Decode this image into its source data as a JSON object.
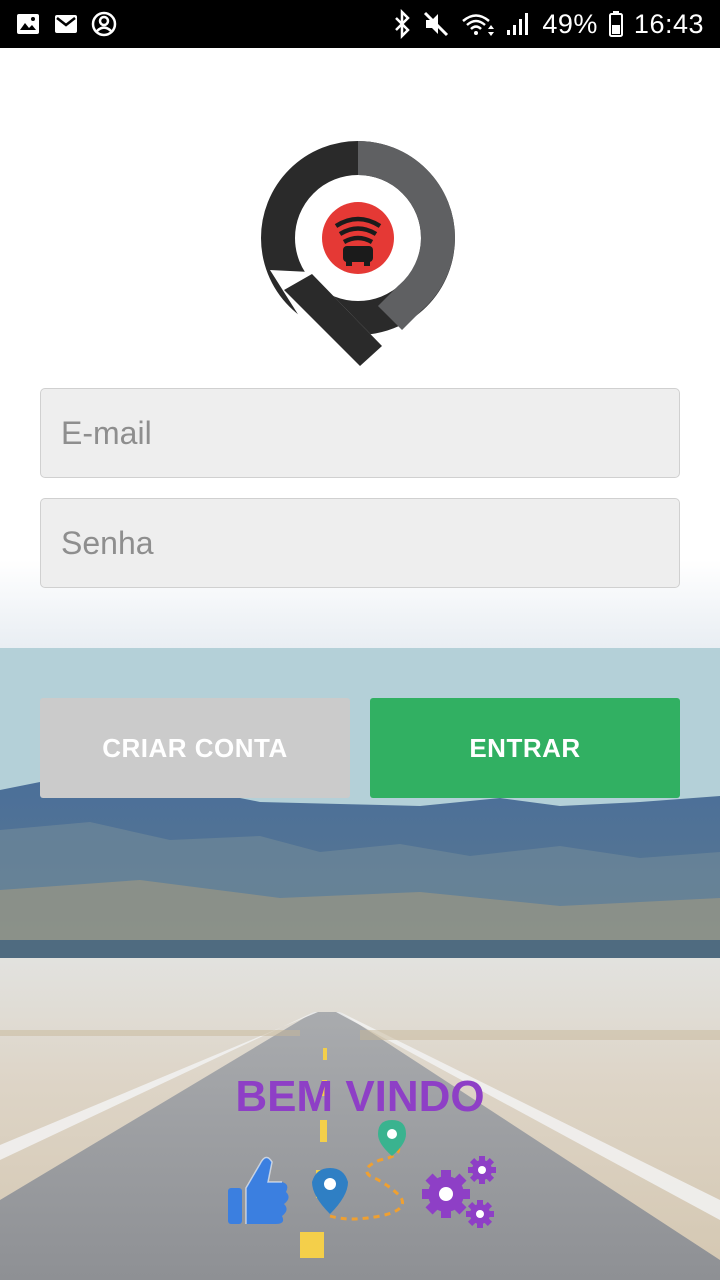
{
  "status_bar": {
    "battery": "49%",
    "time": "16:43",
    "left_icons": [
      "image-icon",
      "mail-icon",
      "account-circle-icon"
    ],
    "right_icons": [
      "bluetooth-icon",
      "mute-icon",
      "wifi-icon",
      "signal-icon",
      "battery-icon"
    ]
  },
  "logo": {
    "icon": "location-pin-car-logo",
    "accent_color": "#e53935"
  },
  "login": {
    "email_placeholder": "E-mail",
    "password_placeholder": "Senha"
  },
  "buttons": {
    "create_account": "CRIAR CONTA",
    "enter": "ENTRAR",
    "create_color": "#cbcbcb",
    "enter_color": "#31b062"
  },
  "welcome": {
    "text": "BEM VINDO",
    "text_color": "#8e3fc6",
    "icons": [
      "thumbs-up-icon",
      "route-map-icon",
      "gears-icon"
    ]
  }
}
